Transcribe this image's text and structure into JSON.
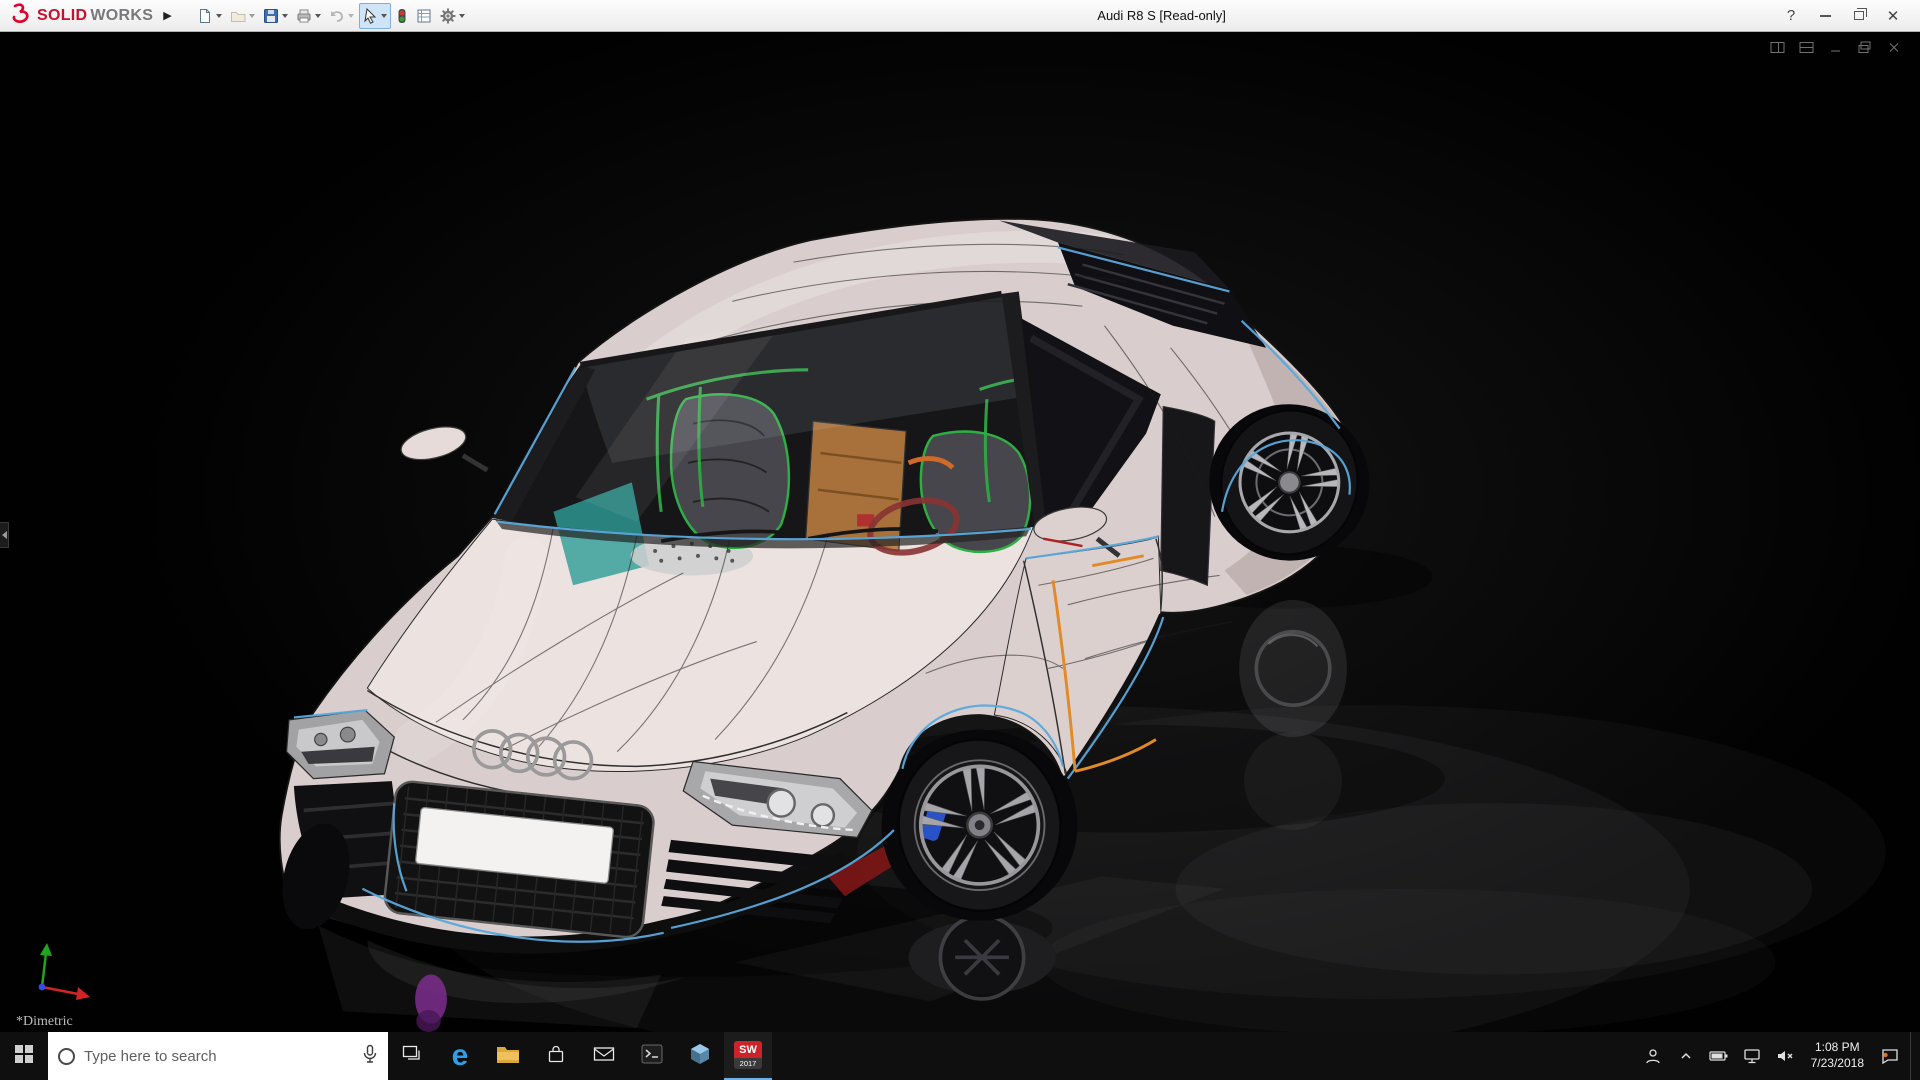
{
  "titlebar": {
    "brand": {
      "solid": "SOLID",
      "works": "WORKS"
    },
    "title": "Audi R8 S [Read-only]",
    "icons": {
      "expand": "▶",
      "help": "?",
      "close": "✕"
    }
  },
  "toolbar": {
    "tools": [
      "new-document",
      "open",
      "save",
      "print",
      "undo",
      "select",
      "rebuild",
      "file-properties",
      "options"
    ]
  },
  "viewport": {
    "orientation_label": "*Dimetric"
  },
  "taskbar": {
    "search": {
      "placeholder": "Type here to search"
    },
    "edge_glyph": "e",
    "solidworks_tile": {
      "line1": "SW",
      "line2": "2017"
    },
    "tray": {
      "time": "1:08 PM",
      "date": "7/23/2018"
    }
  },
  "colors": {
    "accent_blue": "#5aa8dc",
    "accent_orange": "#e08a28",
    "selection_blue": "#cfe4f7",
    "brand_red": "#c8102e"
  }
}
